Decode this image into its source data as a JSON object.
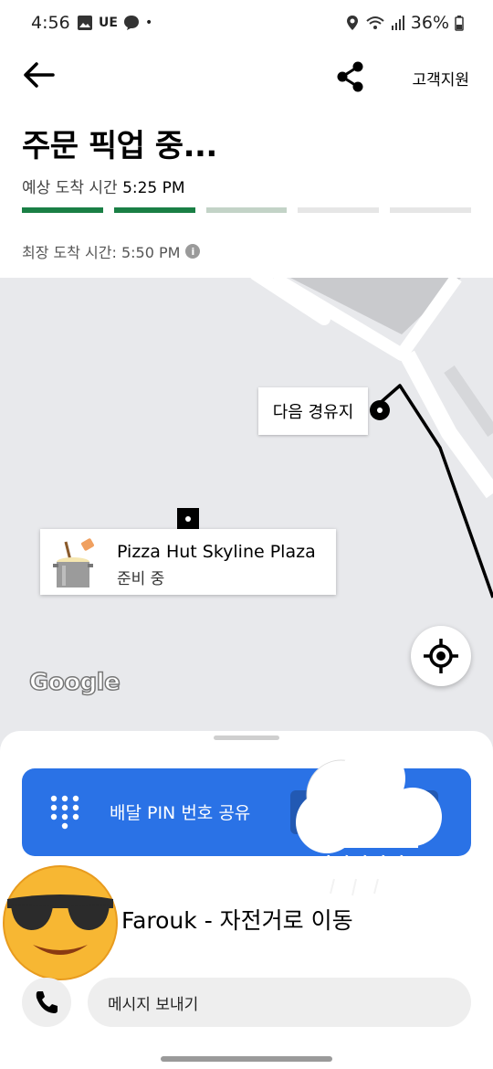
{
  "status_bar": {
    "time": "4:56",
    "carrier_badge": "UE",
    "battery": "36%"
  },
  "header": {
    "support_label": "고객지원"
  },
  "order": {
    "title": "주문 픽업 중...",
    "eta_label": "예상 도착 시간",
    "eta_time": "5:25 PM",
    "latest_label": "최장 도착 시간: 5:50 PM",
    "progress_steps": [
      {
        "state": "done"
      },
      {
        "state": "done"
      },
      {
        "state": "active"
      },
      {
        "state": "pending"
      },
      {
        "state": "pending"
      }
    ]
  },
  "map": {
    "waypoint_label": "다음 경유지",
    "store_name": "Pizza Hut Skyline Plaza",
    "store_status": "준비 중",
    "attribution": "Google"
  },
  "sheet": {
    "pin_button_label": "배달 PIN 번호 공유",
    "courier_text": "Farouk - 자전거로 이동",
    "message_placeholder": "메시지 보내기"
  },
  "colors": {
    "accent_blue": "#2a72e6",
    "progress_done": "#1a7f45",
    "progress_active": "#c3d3c7",
    "progress_pending": "#e6e6e6"
  },
  "icons": [
    "back-arrow-icon",
    "share-icon",
    "info-icon",
    "locate-icon",
    "keypad-icon",
    "phone-icon",
    "cooking-pot-icon",
    "sunglasses-emoji-icon",
    "cloud-rain-icon"
  ]
}
